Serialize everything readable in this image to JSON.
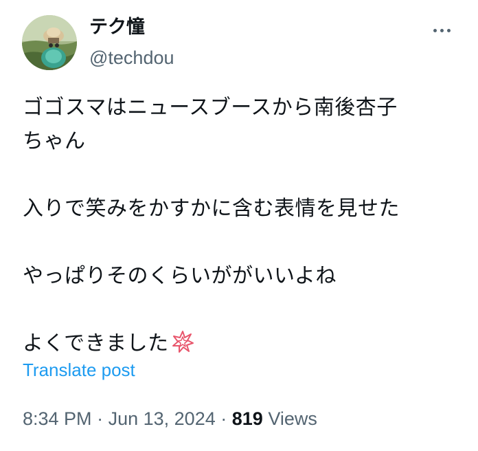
{
  "author": {
    "display_name": "テク憧",
    "handle": "@techdou"
  },
  "more_icon": "more-horizontal-icon",
  "post": {
    "lines": [
      "ゴゴスマはニュースブースから南後杏子",
      "ちゃん",
      "入りで笑みをかすかに含む表情を見せた",
      "やっぱりそのくらいががいいよね",
      "よくできました"
    ],
    "emoji": "white-flower-emoji"
  },
  "translate_label": "Translate post",
  "meta": {
    "time": "8:34 PM",
    "separator": "·",
    "date": "Jun 13, 2024",
    "views_count": "819",
    "views_label": "Views"
  },
  "colors": {
    "text": "#0f1419",
    "secondary": "#536471",
    "link": "#1d9bf0",
    "emoji": "#e8556b"
  }
}
